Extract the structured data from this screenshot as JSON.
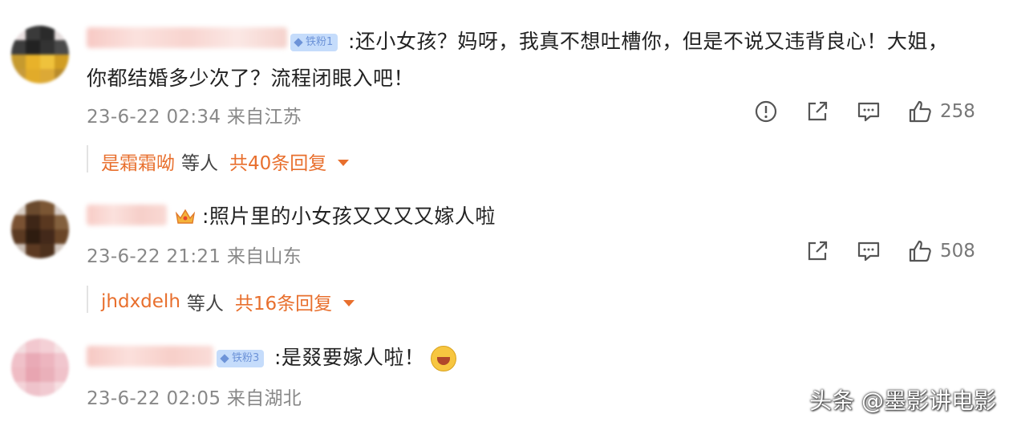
{
  "comments": [
    {
      "badge": "铁粉1",
      "text_line1": ":还小女孩？妈呀，我真不想吐槽你，但是不说又违背良心！大姐，",
      "text_line2": "你都结婚多少次了？流程闭眼入吧！",
      "meta": "23-6-22 02:34 来自江苏",
      "likes": "258",
      "reply_first_user": "是霜霜呦",
      "reply_etc": "等人",
      "reply_total": "共40条回复"
    },
    {
      "text_line1": ":照片里的小女孩又又又又嫁人啦",
      "meta": "23-6-22 21:21 来自山东",
      "likes": "508",
      "reply_first_user": "jhdxdelh",
      "reply_etc": "等人",
      "reply_total": "共16条回复"
    },
    {
      "badge": "铁粉3",
      "text_line1": ":是叕要嫁人啦！",
      "meta": "23-6-22 02:05 来自湖北"
    }
  ],
  "icons": {
    "report": "report-icon",
    "share": "share-icon",
    "comment": "comment-icon",
    "like": "thumbs-up-icon",
    "expand": "caret-down-icon"
  },
  "colors": {
    "reply_link": "#e86f2d",
    "meta_text": "#888888",
    "badge_bg": "#c5dcfb",
    "badge_text": "#6d93d8"
  },
  "watermark": "头条 @墨影讲电影"
}
